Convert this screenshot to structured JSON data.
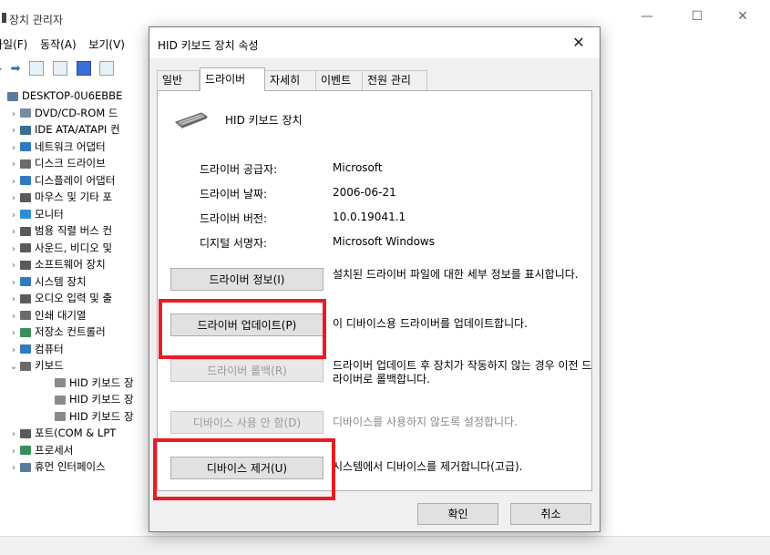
{
  "background_window": {
    "title": "장치 관리자",
    "controls": {
      "minimize": "—",
      "maximize": "☐",
      "close": "✕"
    },
    "menu": [
      "파일(F)",
      "동작(A)",
      "보기(V)"
    ],
    "tree": {
      "root": "DESKTOP-0U6EBBE",
      "items": [
        {
          "label": "DVD/CD-ROM 드",
          "color": "#7a8ba0"
        },
        {
          "label": "IDE ATA/ATAPI 컨",
          "color": "#3b6e8f"
        },
        {
          "label": "네트워크 어댑터",
          "color": "#2e7bbf"
        },
        {
          "label": "디스크 드라이브",
          "color": "#6b6b6b"
        },
        {
          "label": "디스플레이 어댑터",
          "color": "#2e7bbf"
        },
        {
          "label": "마우스 및 기타 포",
          "color": "#5a5a5a"
        },
        {
          "label": "모니터",
          "color": "#2e8fd0"
        },
        {
          "label": "범용 직렬 버스 컨",
          "color": "#5a5a5a"
        },
        {
          "label": "사운드, 비디오 및",
          "color": "#5a5a5a"
        },
        {
          "label": "소프트웨어 장치",
          "color": "#5a5a5a"
        },
        {
          "label": "시스템 장치",
          "color": "#2e7bbf"
        },
        {
          "label": "오디오 입력 및 출",
          "color": "#5a5a5a"
        },
        {
          "label": "인쇄 대기열",
          "color": "#6b6b6b"
        },
        {
          "label": "저장소 컨트롤러",
          "color": "#3b8f5e"
        },
        {
          "label": "컴퓨터",
          "color": "#2e7bbf"
        },
        {
          "label": "키보드",
          "color": "#6b6b6b",
          "expanded": true
        },
        {
          "label": "HID 키보드 장",
          "color": "#8a8a8a",
          "child": true
        },
        {
          "label": "HID 키보드 장",
          "color": "#8a8a8a",
          "child": true
        },
        {
          "label": "HID 키보드 장",
          "color": "#8a8a8a",
          "child": true
        },
        {
          "label": "포트(COM & LPT",
          "color": "#5a5a5a"
        },
        {
          "label": "프로세서",
          "color": "#3b8f5e"
        },
        {
          "label": "휴먼 인터페이스",
          "color": "#5a7a9a"
        }
      ]
    }
  },
  "dialog": {
    "title": "HID 키보드 장치 속성",
    "close_icon": "✕",
    "tabs": [
      "일반",
      "드라이버",
      "자세히",
      "이벤트",
      "전원 관리"
    ],
    "active_tab": "드라이버",
    "device_name": "HID 키보드 장치",
    "properties": [
      {
        "label": "드라이버 공급자:",
        "value": "Microsoft"
      },
      {
        "label": "드라이버 날짜:",
        "value": "2006-06-21"
      },
      {
        "label": "드라이버 버전:",
        "value": "10.0.19041.1"
      },
      {
        "label": "디지털 서명자:",
        "value": "Microsoft Windows"
      }
    ],
    "actions": [
      {
        "button": "드라이버 정보(I)",
        "description": "설치된 드라이버 파일에 대한 세부 정보를 표시합니다.",
        "enabled": true
      },
      {
        "button": "드라이버 업데이트(P)",
        "description": "이 디바이스용 드라이버를 업데이트합니다.",
        "enabled": true,
        "highlighted": true
      },
      {
        "button": "드라이버 롤백(R)",
        "description": "드라이버 업데이트 후 장치가 작동하지 않는 경우 이전 드라이버로 롤백합니다.",
        "enabled": false
      },
      {
        "button": "디바이스 사용 안 함(D)",
        "description": "디바이스를 사용하지 않도록 설정합니다.",
        "enabled": false
      },
      {
        "button": "디바이스 제거(U)",
        "description": "시스템에서 디바이스를 제거합니다(고급).",
        "enabled": true,
        "highlighted": true
      }
    ],
    "ok_label": "확인",
    "cancel_label": "취소",
    "highlight_color": "#e51e25"
  }
}
